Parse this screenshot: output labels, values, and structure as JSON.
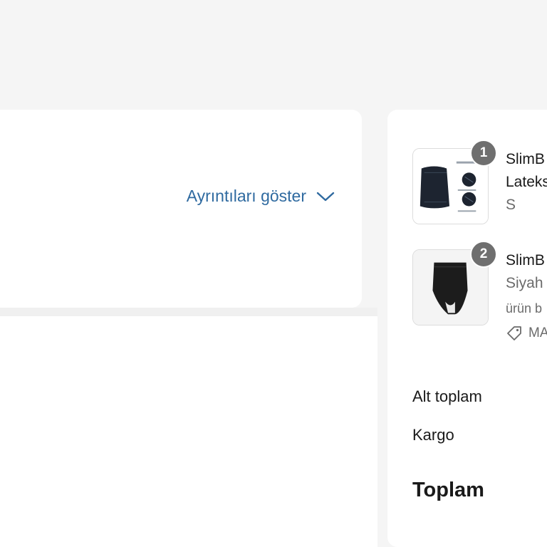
{
  "details": {
    "toggle_label": "Ayrıntıları göster"
  },
  "summary": {
    "items": [
      {
        "quantity": "1",
        "title": "SlimB",
        "subtitle": "Lateks",
        "variant": "S"
      },
      {
        "quantity": "2",
        "title": "SlimB",
        "variant": "Siyah",
        "note": "ürün b",
        "discount_code": "MA"
      }
    ],
    "subtotal_label": "Alt toplam",
    "shipping_label": "Kargo",
    "total_label": "Toplam"
  },
  "colors": {
    "page_bg": "#f5f5f5",
    "card_bg": "#ffffff",
    "link": "#2f6aa0",
    "badge": "#6f6f6f"
  }
}
